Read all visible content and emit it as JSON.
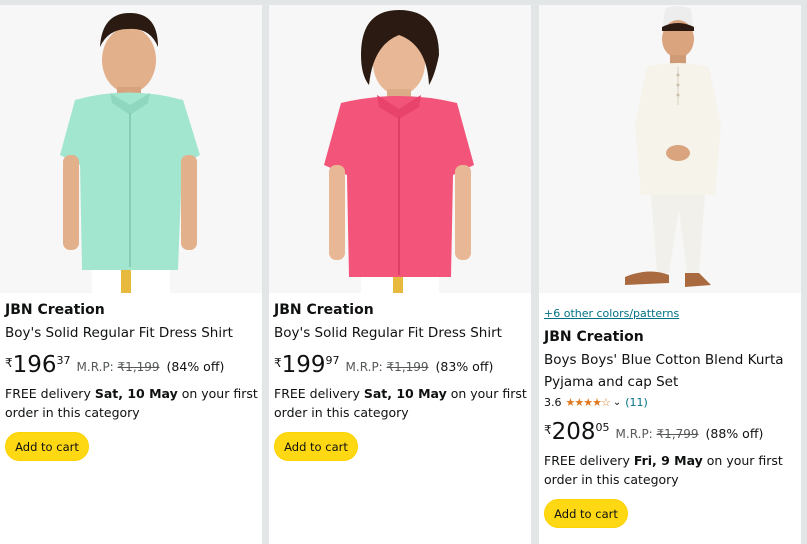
{
  "products": [
    {
      "brand": "JBN Creation",
      "title": "Boy's Solid Regular Fit Dress Shirt",
      "currency": "₹",
      "price_whole": "196",
      "price_fraction": "37",
      "mrp_label": "M.R.P:",
      "mrp_value": "₹1,199",
      "discount": "(84% off)",
      "delivery_prefix": "FREE delivery ",
      "delivery_date": "Sat, 10 May",
      "delivery_suffix": " on your first order in this category",
      "cart_label": "Add to cart",
      "shirt_color": "#a3e6cf"
    },
    {
      "brand": "JBN Creation",
      "title": "Boy's Solid Regular Fit Dress Shirt",
      "currency": "₹",
      "price_whole": "199",
      "price_fraction": "97",
      "mrp_label": "M.R.P:",
      "mrp_value": "₹1,199",
      "discount": "(83% off)",
      "delivery_prefix": "FREE delivery ",
      "delivery_date": "Sat, 10 May",
      "delivery_suffix": " on your first order in this category",
      "cart_label": "Add to cart",
      "shirt_color": "#f2547a"
    },
    {
      "swatch_link": "+6 other colors/patterns",
      "brand": "JBN Creation",
      "title": "Boys Boys' Blue Cotton Blend Kurta Pyjama and cap Set",
      "rating_value": "3.6",
      "rating_stars": "★★★★☆",
      "rating_count": "(11)",
      "currency": "₹",
      "price_whole": "208",
      "price_fraction": "05",
      "mrp_label": "M.R.P:",
      "mrp_value": "₹1,799",
      "discount": "(88% off)",
      "delivery_prefix": "FREE delivery ",
      "delivery_date": "Fri, 9 May",
      "delivery_suffix": " on your first order in this category",
      "cart_label": "Add to cart",
      "kurta_color": "#f6f3ea"
    }
  ],
  "colors": {
    "star": "#de7921",
    "link": "#007185",
    "cart_button": "#ffd814"
  }
}
